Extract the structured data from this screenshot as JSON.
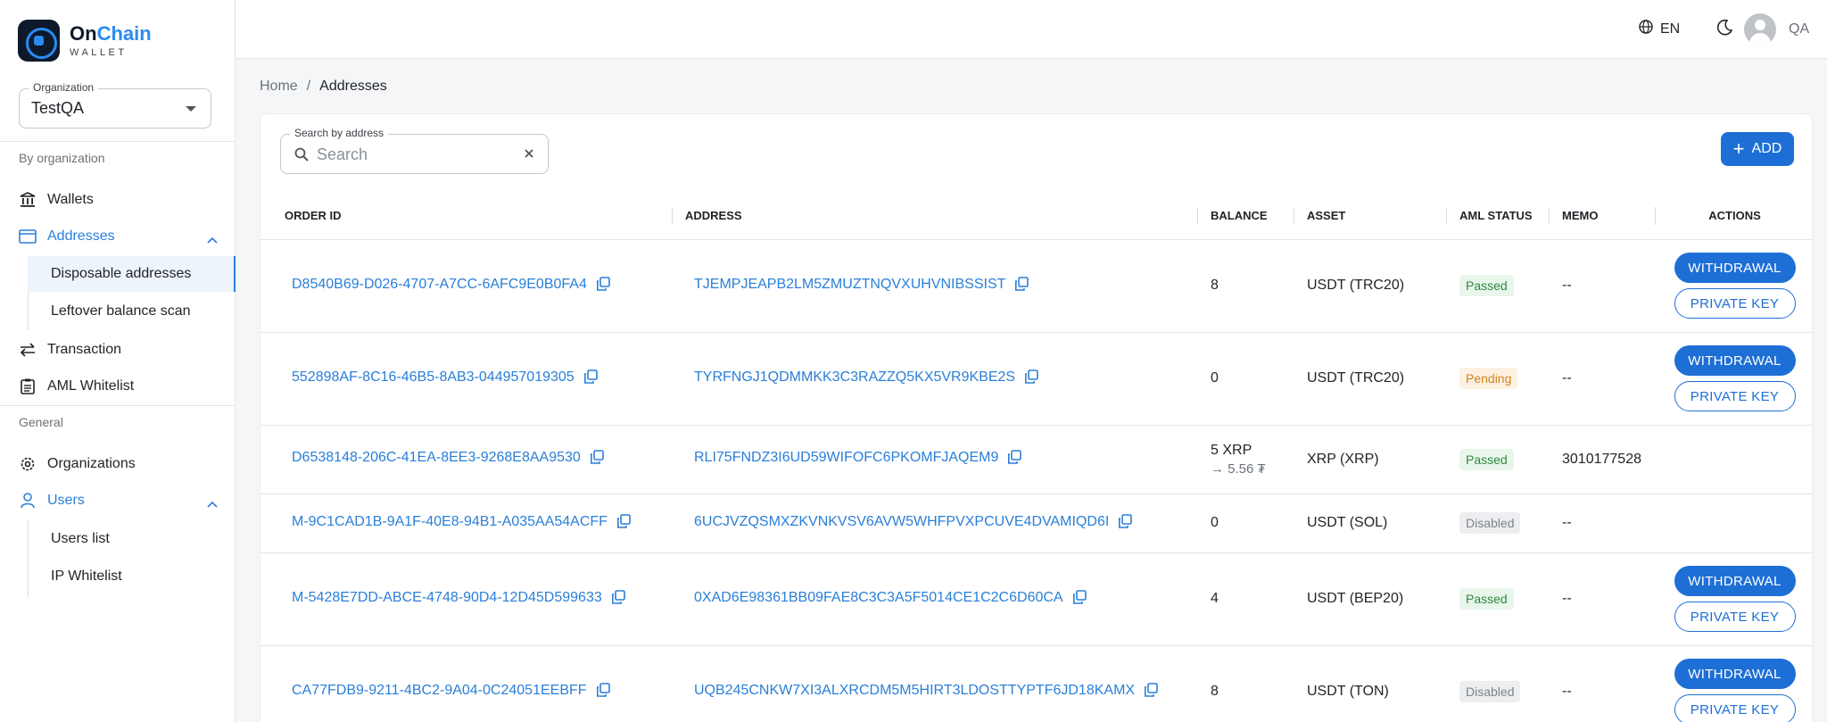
{
  "app": {
    "name_part1": "On",
    "name_part2": "Chain",
    "subtitle": "WALLET"
  },
  "organization": {
    "label": "Organization",
    "value": "TestQA"
  },
  "sidebar": {
    "section_by_org": "By organization",
    "section_general": "General",
    "wallets": "Wallets",
    "addresses": "Addresses",
    "disposable": "Disposable addresses",
    "leftover": "Leftover balance scan",
    "transaction": "Transaction",
    "aml": "AML Whitelist",
    "organizations": "Organizations",
    "users": "Users",
    "users_list": "Users list",
    "ip_whitelist": "IP Whitelist"
  },
  "topbar": {
    "language": "EN",
    "user": "QA"
  },
  "breadcrumb": {
    "home": "Home",
    "sep": "/",
    "current": "Addresses"
  },
  "search": {
    "label": "Search by address",
    "placeholder": "Search"
  },
  "add_label": "ADD",
  "columns": {
    "order_id": "ORDER ID",
    "address": "ADDRESS",
    "balance": "BALANCE",
    "asset": "ASSET",
    "aml_status": "AML STATUS",
    "memo": "MEMO",
    "actions": "ACTIONS"
  },
  "buttons": {
    "withdrawal": "WITHDRAWAL",
    "private_key": "PRIVATE KEY"
  },
  "rows": [
    {
      "order_id": "D8540B69-D026-4707-A7CC-6AFC9E0B0FA4",
      "address": "TJEMPJEAPB2LM5ZMUZTNQVXUHVNIBSSIST",
      "balance": "8",
      "balance_sub": "",
      "asset": "USDT (TRC20)",
      "aml": "Passed",
      "memo": "--"
    },
    {
      "order_id": "552898AF-8C16-46B5-8AB3-044957019305",
      "address": "TYRFNGJ1QDMMKK3C3RAZZQ5KX5VR9KBE2S",
      "balance": "0",
      "balance_sub": "",
      "asset": "USDT (TRC20)",
      "aml": "Pending",
      "memo": "--"
    },
    {
      "order_id": "D6538148-206C-41EA-8EE3-9268E8AA9530",
      "address": "RLI75FNDZ3I6UD59WIFOFC6PKOMFJAQEM9",
      "balance": "5 XRP",
      "balance_sub": "→ 5.56 ₮",
      "asset": "XRP (XRP)",
      "aml": "Passed",
      "memo": "3010177528"
    },
    {
      "order_id": "M-9C1CAD1B-9A1F-40E8-94B1-A035AA54ACFF",
      "address": "6UCJVZQSMXZKVNKVSV6AVW5WHFPVXPCUVE4DVAMIQD6I",
      "balance": "0",
      "balance_sub": "",
      "asset": "USDT (SOL)",
      "aml": "Disabled",
      "memo": "--"
    },
    {
      "order_id": "M-5428E7DD-ABCE-4748-90D4-12D45D599633",
      "address": "0XAD6E98361BB09FAE8C3C3A5F5014CE1C2C6D60CA",
      "balance": "4",
      "balance_sub": "",
      "asset": "USDT (BEP20)",
      "aml": "Passed",
      "memo": "--"
    },
    {
      "order_id": "CA77FDB9-9211-4BC2-9A04-0C24051EEBFF",
      "address": "UQB245CNKW7XI3ALXRCDM5M5HIRT3LDOSTTYPTF6JD18KAMX",
      "balance": "8",
      "balance_sub": "",
      "asset": "USDT (TON)",
      "aml": "Disabled",
      "memo": "--"
    }
  ],
  "colors": {
    "accent": "#1d6fd6",
    "link": "#2a7fd8",
    "passed": "#2f8a3d",
    "pending": "#d3821c",
    "disabled": "#7d848b"
  }
}
